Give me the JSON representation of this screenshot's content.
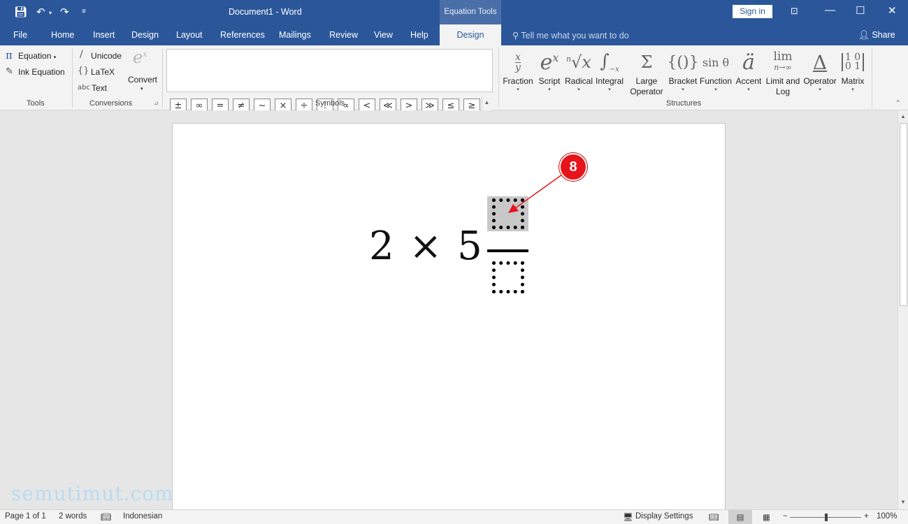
{
  "titlebar": {
    "doc_title": "Document1  -  Word",
    "context_tab": "Equation Tools",
    "sign_in": "Sign in"
  },
  "tabs": [
    {
      "label": "File"
    },
    {
      "label": "Home"
    },
    {
      "label": "Insert"
    },
    {
      "label": "Design"
    },
    {
      "label": "Layout"
    },
    {
      "label": "References"
    },
    {
      "label": "Mailings"
    },
    {
      "label": "Review"
    },
    {
      "label": "View"
    },
    {
      "label": "Help"
    }
  ],
  "active_tab": "Design",
  "tell_me": "Tell me what you want to do",
  "share": "Share",
  "ribbon": {
    "tools": {
      "label": "Tools",
      "equation": "Equation",
      "ink_equation": "Ink Equation"
    },
    "conversions": {
      "label": "Conversions",
      "unicode": "Unicode",
      "latex": "LaTeX",
      "text": "Text",
      "convert": "Convert"
    },
    "symbols": {
      "label": "Symbols",
      "row1": [
        "±",
        "∞",
        "=",
        "≠",
        "~",
        "×",
        "÷",
        "!",
        "∝",
        "<",
        "≪",
        ">",
        "≫",
        "≤",
        "≥"
      ],
      "row2": [
        "∓",
        "≅",
        "≈",
        "≡",
        "∀",
        "∁",
        "∂",
        "√",
        "∛",
        "∜",
        "∪",
        "∩",
        "∅",
        "%",
        "°"
      ]
    },
    "structures": {
      "label": "Structures",
      "items": [
        {
          "label": "Fraction",
          "icon": "fraction-icon"
        },
        {
          "label": "Script",
          "icon": "script-icon"
        },
        {
          "label": "Radical",
          "icon": "radical-icon"
        },
        {
          "label": "Integral",
          "icon": "integral-icon"
        },
        {
          "label": "Large\nOperator",
          "icon": "large-operator-icon"
        },
        {
          "label": "Bracket",
          "icon": "bracket-icon"
        },
        {
          "label": "Function",
          "icon": "function-icon"
        },
        {
          "label": "Accent",
          "icon": "accent-icon"
        },
        {
          "label": "Limit and\nLog",
          "icon": "limit-log-icon"
        },
        {
          "label": "Operator",
          "icon": "operator-icon"
        },
        {
          "label": "Matrix",
          "icon": "matrix-icon"
        }
      ]
    }
  },
  "document": {
    "equation_text": "2 × 5",
    "callout_number": "8",
    "watermark": "semutimut.com"
  },
  "status": {
    "page": "Page 1 of 1",
    "words": "2 words",
    "language": "Indonesian",
    "display_settings": "Display Settings",
    "zoom": "100%"
  },
  "colors": {
    "brand": "#2b579a",
    "callout": "#e8141c"
  }
}
